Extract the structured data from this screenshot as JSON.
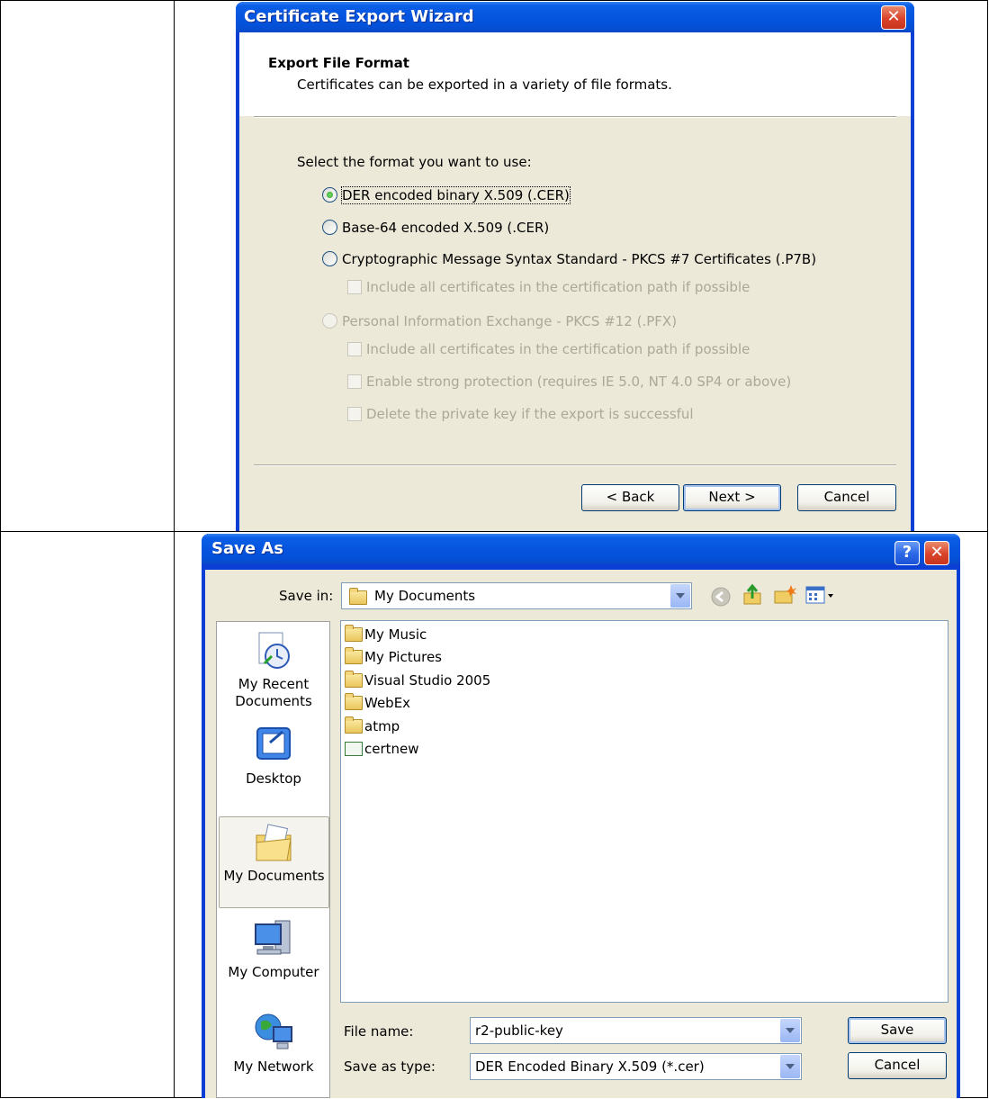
{
  "wizard": {
    "title": "Certificate Export Wizard",
    "close_icon": "close-icon",
    "header_title": "Export File Format",
    "header_subtitle": "Certificates can be exported in a variety of file formats.",
    "select_prompt": "Select the format you want to use:",
    "options": [
      {
        "label": "DER encoded binary X.509 (.CER)",
        "selected": true,
        "enabled": true
      },
      {
        "label": "Base-64 encoded X.509 (.CER)",
        "selected": false,
        "enabled": true
      },
      {
        "label": "Cryptographic Message Syntax Standard - PKCS #7 Certificates (.P7B)",
        "selected": false,
        "enabled": true
      },
      {
        "label": "Personal Information Exchange - PKCS #12 (.PFX)",
        "selected": false,
        "enabled": false
      }
    ],
    "checkboxes": [
      {
        "label": "Include all certificates in the certification path if possible",
        "checked": false,
        "enabled": false
      },
      {
        "label": "Include all certificates in the certification path if possible",
        "checked": false,
        "enabled": false
      },
      {
        "label": "Enable strong protection (requires IE 5.0, NT 4.0 SP4 or above)",
        "checked": false,
        "enabled": false
      },
      {
        "label": "Delete the private key if the export is successful",
        "checked": false,
        "enabled": false
      }
    ],
    "buttons": {
      "back": "< Back",
      "next": "Next >",
      "cancel": "Cancel"
    }
  },
  "save_as": {
    "title": "Save As",
    "help_icon": "help-icon",
    "close_icon": "close-icon",
    "save_in_label": "Save in:",
    "save_in_value": "My Documents",
    "places": [
      {
        "label_line1": "My Recent",
        "label_line2": "Documents",
        "icon": "recent-documents-icon"
      },
      {
        "label_line1": "Desktop",
        "label_line2": "",
        "icon": "desktop-icon"
      },
      {
        "label_line1": "My Documents",
        "label_line2": "",
        "icon": "my-documents-icon"
      },
      {
        "label_line1": "My Computer",
        "label_line2": "",
        "icon": "my-computer-icon"
      },
      {
        "label_line1": "My Network",
        "label_line2": "",
        "icon": "my-network-icon"
      }
    ],
    "files": [
      {
        "name": "My Music",
        "icon": "music-folder-icon"
      },
      {
        "name": "My Pictures",
        "icon": "pictures-folder-icon"
      },
      {
        "name": "Visual Studio 2005",
        "icon": "folder-icon"
      },
      {
        "name": "WebEx",
        "icon": "folder-icon"
      },
      {
        "name": "atmp",
        "icon": "shortcut-folder-icon"
      },
      {
        "name": "certnew",
        "icon": "certificate-file-icon"
      }
    ],
    "file_name_label": "File name:",
    "file_name_value": "r2-public-key",
    "save_type_label": "Save as type:",
    "save_type_value": "DER Encoded Binary X.509 (*.cer)",
    "save_button": "Save",
    "cancel_button": "Cancel"
  }
}
